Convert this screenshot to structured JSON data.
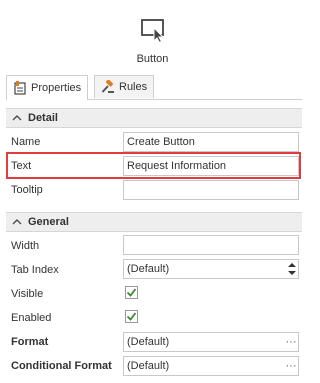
{
  "header": {
    "title": "Button",
    "icon": "button-cursor-icon"
  },
  "tabs": [
    {
      "label": "Properties",
      "icon": "properties-icon"
    },
    {
      "label": "Rules",
      "icon": "gavel-icon"
    }
  ],
  "sections": {
    "detail": {
      "label": "Detail"
    },
    "general": {
      "label": "General"
    }
  },
  "fields": {
    "name": {
      "label": "Name",
      "value": "Create Button"
    },
    "text": {
      "label": "Text",
      "value": "Request Information"
    },
    "tooltip": {
      "label": "Tooltip",
      "value": ""
    },
    "width": {
      "label": "Width",
      "value": ""
    },
    "tab_index": {
      "label": "Tab Index",
      "value": "(Default)"
    },
    "visible": {
      "label": "Visible",
      "checked": true
    },
    "enabled": {
      "label": "Enabled",
      "checked": true
    },
    "format": {
      "label": "Format",
      "value": "(Default)",
      "button": "···"
    },
    "conditional_format": {
      "label": "Conditional Format",
      "value": "(Default)",
      "button": "···"
    }
  },
  "colors": {
    "highlight": "#e23b3b",
    "check": "#3a8a2a"
  }
}
